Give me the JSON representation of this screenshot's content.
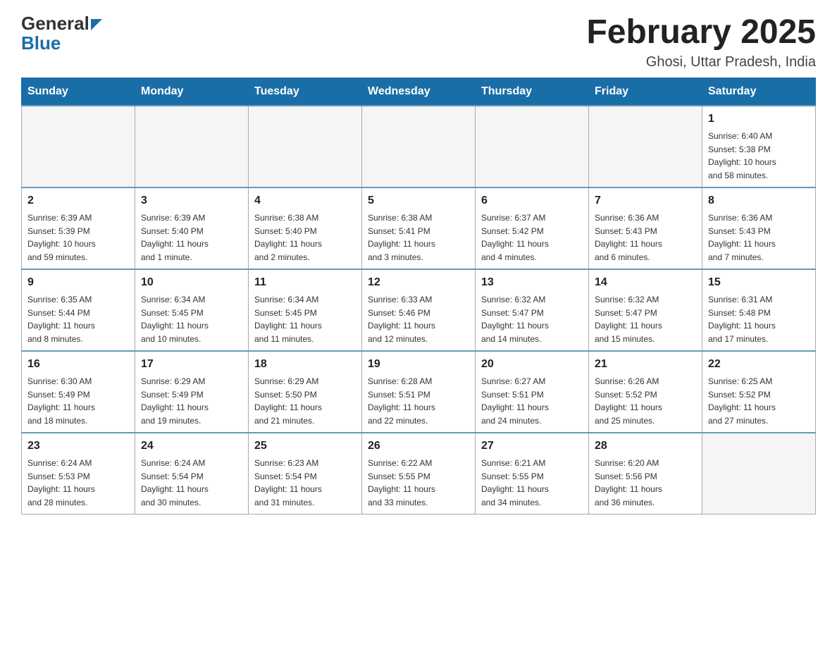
{
  "header": {
    "logo_general": "General",
    "logo_blue": "Blue",
    "title": "February 2025",
    "subtitle": "Ghosi, Uttar Pradesh, India"
  },
  "weekdays": [
    "Sunday",
    "Monday",
    "Tuesday",
    "Wednesday",
    "Thursday",
    "Friday",
    "Saturday"
  ],
  "weeks": [
    [
      {
        "day": "",
        "info": ""
      },
      {
        "day": "",
        "info": ""
      },
      {
        "day": "",
        "info": ""
      },
      {
        "day": "",
        "info": ""
      },
      {
        "day": "",
        "info": ""
      },
      {
        "day": "",
        "info": ""
      },
      {
        "day": "1",
        "info": "Sunrise: 6:40 AM\nSunset: 5:38 PM\nDaylight: 10 hours\nand 58 minutes."
      }
    ],
    [
      {
        "day": "2",
        "info": "Sunrise: 6:39 AM\nSunset: 5:39 PM\nDaylight: 10 hours\nand 59 minutes."
      },
      {
        "day": "3",
        "info": "Sunrise: 6:39 AM\nSunset: 5:40 PM\nDaylight: 11 hours\nand 1 minute."
      },
      {
        "day": "4",
        "info": "Sunrise: 6:38 AM\nSunset: 5:40 PM\nDaylight: 11 hours\nand 2 minutes."
      },
      {
        "day": "5",
        "info": "Sunrise: 6:38 AM\nSunset: 5:41 PM\nDaylight: 11 hours\nand 3 minutes."
      },
      {
        "day": "6",
        "info": "Sunrise: 6:37 AM\nSunset: 5:42 PM\nDaylight: 11 hours\nand 4 minutes."
      },
      {
        "day": "7",
        "info": "Sunrise: 6:36 AM\nSunset: 5:43 PM\nDaylight: 11 hours\nand 6 minutes."
      },
      {
        "day": "8",
        "info": "Sunrise: 6:36 AM\nSunset: 5:43 PM\nDaylight: 11 hours\nand 7 minutes."
      }
    ],
    [
      {
        "day": "9",
        "info": "Sunrise: 6:35 AM\nSunset: 5:44 PM\nDaylight: 11 hours\nand 8 minutes."
      },
      {
        "day": "10",
        "info": "Sunrise: 6:34 AM\nSunset: 5:45 PM\nDaylight: 11 hours\nand 10 minutes."
      },
      {
        "day": "11",
        "info": "Sunrise: 6:34 AM\nSunset: 5:45 PM\nDaylight: 11 hours\nand 11 minutes."
      },
      {
        "day": "12",
        "info": "Sunrise: 6:33 AM\nSunset: 5:46 PM\nDaylight: 11 hours\nand 12 minutes."
      },
      {
        "day": "13",
        "info": "Sunrise: 6:32 AM\nSunset: 5:47 PM\nDaylight: 11 hours\nand 14 minutes."
      },
      {
        "day": "14",
        "info": "Sunrise: 6:32 AM\nSunset: 5:47 PM\nDaylight: 11 hours\nand 15 minutes."
      },
      {
        "day": "15",
        "info": "Sunrise: 6:31 AM\nSunset: 5:48 PM\nDaylight: 11 hours\nand 17 minutes."
      }
    ],
    [
      {
        "day": "16",
        "info": "Sunrise: 6:30 AM\nSunset: 5:49 PM\nDaylight: 11 hours\nand 18 minutes."
      },
      {
        "day": "17",
        "info": "Sunrise: 6:29 AM\nSunset: 5:49 PM\nDaylight: 11 hours\nand 19 minutes."
      },
      {
        "day": "18",
        "info": "Sunrise: 6:29 AM\nSunset: 5:50 PM\nDaylight: 11 hours\nand 21 minutes."
      },
      {
        "day": "19",
        "info": "Sunrise: 6:28 AM\nSunset: 5:51 PM\nDaylight: 11 hours\nand 22 minutes."
      },
      {
        "day": "20",
        "info": "Sunrise: 6:27 AM\nSunset: 5:51 PM\nDaylight: 11 hours\nand 24 minutes."
      },
      {
        "day": "21",
        "info": "Sunrise: 6:26 AM\nSunset: 5:52 PM\nDaylight: 11 hours\nand 25 minutes."
      },
      {
        "day": "22",
        "info": "Sunrise: 6:25 AM\nSunset: 5:52 PM\nDaylight: 11 hours\nand 27 minutes."
      }
    ],
    [
      {
        "day": "23",
        "info": "Sunrise: 6:24 AM\nSunset: 5:53 PM\nDaylight: 11 hours\nand 28 minutes."
      },
      {
        "day": "24",
        "info": "Sunrise: 6:24 AM\nSunset: 5:54 PM\nDaylight: 11 hours\nand 30 minutes."
      },
      {
        "day": "25",
        "info": "Sunrise: 6:23 AM\nSunset: 5:54 PM\nDaylight: 11 hours\nand 31 minutes."
      },
      {
        "day": "26",
        "info": "Sunrise: 6:22 AM\nSunset: 5:55 PM\nDaylight: 11 hours\nand 33 minutes."
      },
      {
        "day": "27",
        "info": "Sunrise: 6:21 AM\nSunset: 5:55 PM\nDaylight: 11 hours\nand 34 minutes."
      },
      {
        "day": "28",
        "info": "Sunrise: 6:20 AM\nSunset: 5:56 PM\nDaylight: 11 hours\nand 36 minutes."
      },
      {
        "day": "",
        "info": ""
      }
    ]
  ]
}
